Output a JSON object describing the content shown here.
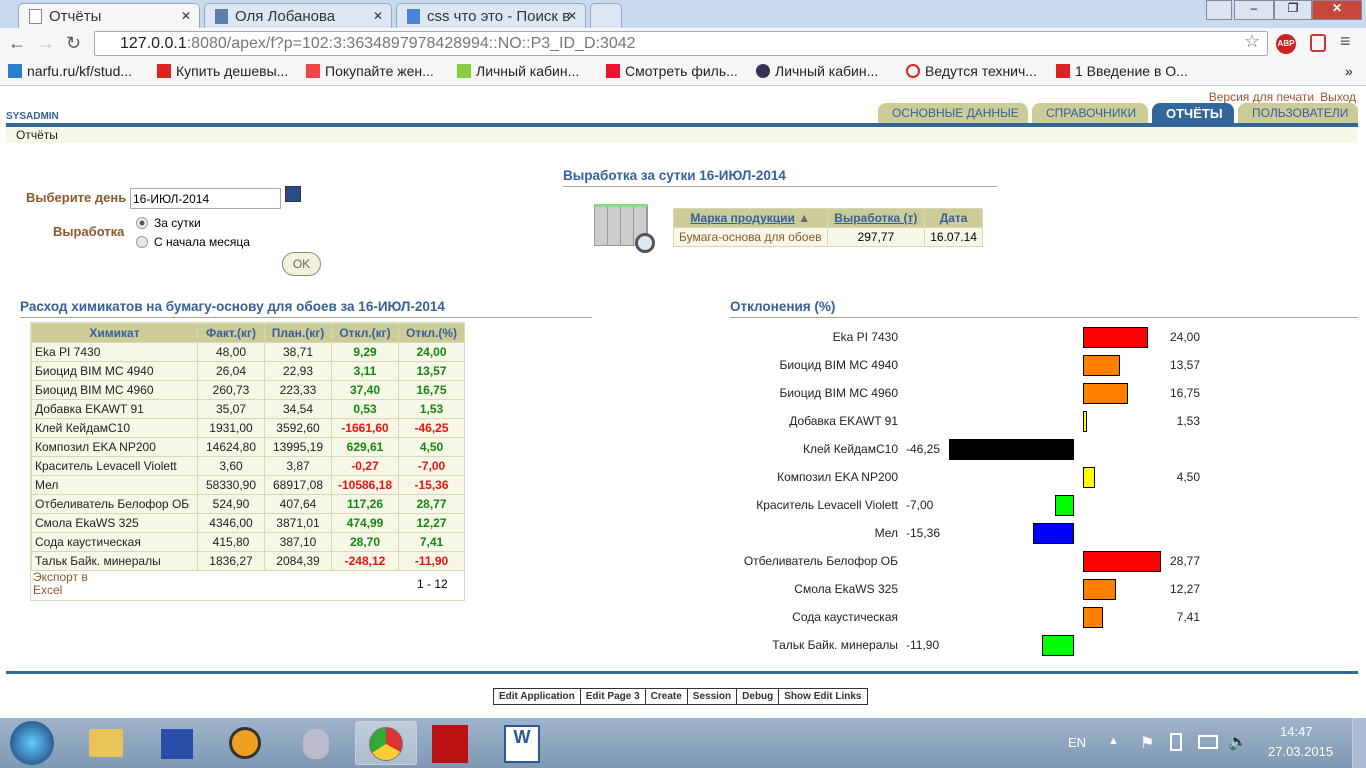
{
  "browser": {
    "tabs": [
      {
        "label": "Отчёты",
        "active": true
      },
      {
        "label": "Оля Лобанова",
        "active": false
      },
      {
        "label": "css что это - Поиск в",
        "active": false
      }
    ],
    "url_host": "127.0.0.1",
    "url_rest": ":8080/apex/f?p=102:3:3634897978428994::NO::P3_ID_D:3042",
    "bookmarks": [
      "narfu.ru/kf/stud...",
      "Купить дешевы...",
      "Покупайте жен...",
      "Личный кабин...",
      "Смотреть филь...",
      "Личный кабин...",
      "Ведутся технич...",
      "1 Введение в О..."
    ]
  },
  "header": {
    "user": "SYSADMIN",
    "print_link": "Версия для печати",
    "logout_link": "Выход",
    "tabs": [
      "ОСНОВНЫЕ ДАННЫЕ",
      "СПРАВОЧНИКИ",
      "ОТЧЁТЫ",
      "ПОЛЬЗОВАТЕЛИ"
    ],
    "breadcrumb": "Отчёты"
  },
  "form": {
    "day_label": "Выберите день",
    "day_value": "16-ИЮЛ-2014",
    "output_label": "Выработка",
    "radio1": "За сутки",
    "radio2": "С начала месяца",
    "ok": "OK"
  },
  "production": {
    "title": "Выработка за сутки 16-ИЮЛ-2014",
    "headers": [
      "Марка продукции",
      "Выработка (т)",
      "Дата"
    ],
    "row": [
      "Бумага-основа для обоев",
      "297,77",
      "16.07.14"
    ]
  },
  "chemicals": {
    "title": "Расход химикатов на бумагу-основу для обоев за 16-ИЮЛ-2014",
    "headers": [
      "Химикат",
      "Факт.(кг)",
      "План.(кг)",
      "Откл.(кг)",
      "Откл.(%)"
    ],
    "rows": [
      [
        "Eka PI 7430",
        "48,00",
        "38,71",
        "9,29",
        "24,00"
      ],
      [
        "Биоцид BIM MC 4940",
        "26,04",
        "22,93",
        "3,11",
        "13,57"
      ],
      [
        "Биоцид BIM MC 4960",
        "260,73",
        "223,33",
        "37,40",
        "16,75"
      ],
      [
        "Добавка EKAWT 91",
        "35,07",
        "34,54",
        "0,53",
        "1,53"
      ],
      [
        "Клей КейдамС10",
        "1931,00",
        "3592,60",
        "-1661,60",
        "-46,25"
      ],
      [
        "Композил EKA NP200",
        "14624,80",
        "13995,19",
        "629,61",
        "4,50"
      ],
      [
        "Краситель Levacell Violett",
        "3,60",
        "3,87",
        "-0,27",
        "-7,00"
      ],
      [
        "Мел",
        "58330,90",
        "68917,08",
        "-10586,18",
        "-15,36"
      ],
      [
        "Отбеливатель Белофор ОБ",
        "524,90",
        "407,64",
        "117,26",
        "28,77"
      ],
      [
        "Смола EkaWS 325",
        "4346,00",
        "3871,01",
        "474,99",
        "12,27"
      ],
      [
        "Сода каустическая",
        "415,80",
        "387,10",
        "28,70",
        "7,41"
      ],
      [
        "Тальк Байк. минералы",
        "1836,27",
        "2084,39",
        "-248,12",
        "-11,90"
      ]
    ],
    "export": "Экспорт в Excel",
    "pagination": "1 - 12"
  },
  "chart_data": {
    "type": "bar",
    "title": "Отклонения (%)",
    "orientation": "horizontal",
    "categories": [
      "Eka PI 7430",
      "Биоцид BIM MC 4940",
      "Биоцид BIM MC 4960",
      "Добавка EKAWT 91",
      "Клей КейдамС10",
      "Композил EKA NP200",
      "Краситель Levacell Violett",
      "Мел",
      "Отбеливатель Белофор ОБ",
      "Смола EkaWS 325",
      "Сода каустическая",
      "Тальк Байк. минералы"
    ],
    "values": [
      24.0,
      13.57,
      16.75,
      1.53,
      -46.25,
      4.5,
      -7.0,
      -15.36,
      28.77,
      12.27,
      7.41,
      -11.9
    ],
    "labels": [
      "24,00",
      "13,57",
      "16,75",
      "1,53",
      "-46,25",
      "4,50",
      "-7,00",
      "-15,36",
      "28,77",
      "12,27",
      "7,41",
      "-11,90"
    ],
    "colors": [
      "#ff0000",
      "#ff8000",
      "#ff8000",
      "#ffff00",
      "#000000",
      "#ffff00",
      "#00ff00",
      "#0000ff",
      "#ff0000",
      "#ff8000",
      "#ff8000",
      "#00ff00"
    ]
  },
  "dev_toolbar": [
    "Edit Application",
    "Edit Page 3",
    "Create",
    "Session",
    "Debug",
    "Show Edit Links"
  ],
  "taskbar": {
    "lang": "EN",
    "time": "14:47",
    "date": "27.03.2015"
  }
}
